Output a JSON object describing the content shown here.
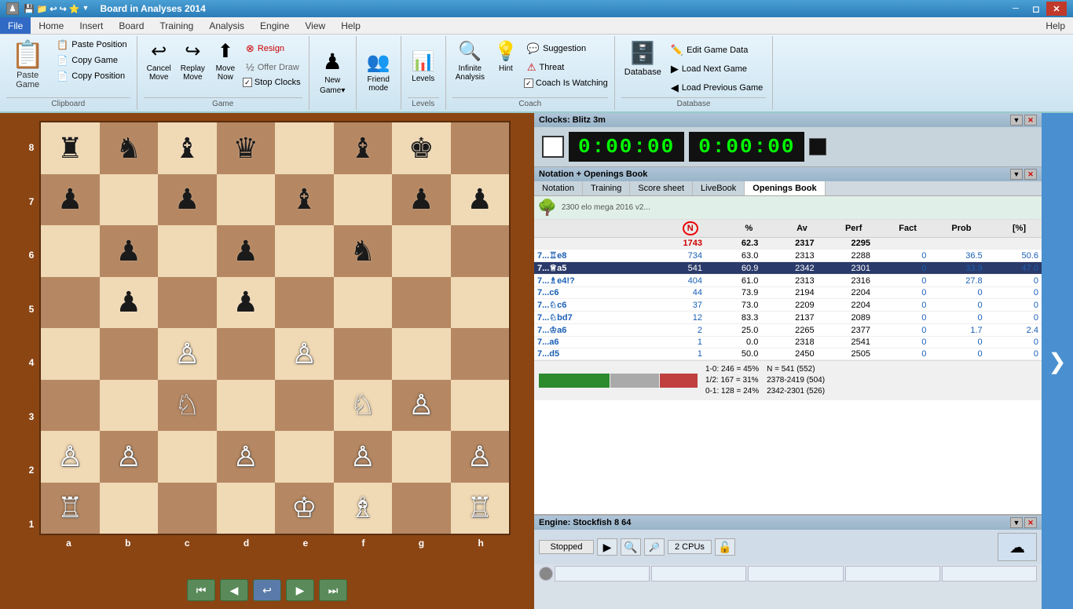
{
  "titleBar": {
    "title": "Board in Analyses 2014",
    "icons": [
      "disk",
      "folder",
      "undo",
      "redo",
      "star"
    ],
    "controls": [
      "minimize",
      "restore",
      "close"
    ]
  },
  "menuBar": {
    "items": [
      "File",
      "Home",
      "Insert",
      "Board",
      "Training",
      "Analysis",
      "Engine",
      "View",
      "Help"
    ],
    "active": "Home",
    "help": "Help"
  },
  "ribbon": {
    "clipboard": {
      "label": "Clipboard",
      "pasteLabel": "Paste Game",
      "items": [
        {
          "label": "Paste Position",
          "icon": "📋"
        },
        {
          "label": "Copy Game",
          "icon": "📄"
        },
        {
          "label": "Copy Position",
          "icon": "📄"
        }
      ]
    },
    "game": {
      "label": "Game",
      "cancelLabel": "Cancel Move",
      "replayLabel": "Replay Move",
      "moveNowLabel": "Move Now",
      "resignLabel": "Resign",
      "drawLabel": "Offer Draw",
      "stopClocksLabel": "Stop Clocks"
    },
    "newGame": {
      "label": "New Game",
      "icon": "♟"
    },
    "friendMode": {
      "label": "Friend mode"
    },
    "levels": {
      "label": "Levels"
    },
    "coach": {
      "label": "Coach",
      "suggestionLabel": "Suggestion",
      "threatLabel": "Threat",
      "infiniteLabel": "Infinite Analysis",
      "hintLabel": "Hint",
      "coachWatchingLabel": "Coach Is Watching"
    },
    "database": {
      "label": "Database",
      "editGameData": "Edit Game Data",
      "loadNextGame": "Load Next Game",
      "loadPreviousGame": "Load Previous Game"
    }
  },
  "clocks": {
    "header": "Clocks: Blitz 3m",
    "white": "0:00:00",
    "black": "0:00:00"
  },
  "notation": {
    "header": "Notation + Openings Book",
    "tabs": [
      "Notation",
      "Training",
      "Score sheet",
      "LiveBook",
      "Openings Book"
    ],
    "activeTab": "Openings Book"
  },
  "openingsBook": {
    "treeInfo": "2300 elo mega 2016 v2...",
    "columns": [
      "N",
      "%",
      "Av",
      "Perf",
      "Fact",
      "Prob",
      "[%]"
    ],
    "totalN": "1743",
    "totalPct": "62.3",
    "totalAv": "2317",
    "totalPerf": "2295",
    "moves": [
      {
        "move": "7...♖e8",
        "n": "734",
        "pct": "63.0",
        "av": "2313",
        "perf": "2288",
        "fact": "0",
        "prob": "36.5",
        "pctbig": "50.6",
        "selected": false
      },
      {
        "move": "7...♕a5",
        "n": "541",
        "pct": "60.9",
        "av": "2342",
        "perf": "2301",
        "fact": "0",
        "prob": "33.9",
        "pctbig": "47.0",
        "selected": true
      },
      {
        "move": "7...♗e4!?",
        "n": "404",
        "pct": "61.0",
        "av": "2313",
        "perf": "2316",
        "fact": "0",
        "prob": "27.8",
        "pctbig": "0",
        "selected": false
      },
      {
        "move": "7...c6",
        "n": "44",
        "pct": "73.9",
        "av": "2194",
        "perf": "2204",
        "fact": "0",
        "prob": "0",
        "pctbig": "0",
        "selected": false
      },
      {
        "move": "7...♘c6",
        "n": "37",
        "pct": "73.0",
        "av": "2209",
        "perf": "2204",
        "fact": "0",
        "prob": "0",
        "pctbig": "0",
        "selected": false
      },
      {
        "move": "7...♘bd7",
        "n": "12",
        "pct": "83.3",
        "av": "2137",
        "perf": "2089",
        "fact": "0",
        "prob": "0",
        "pctbig": "0",
        "selected": false
      },
      {
        "move": "7...♔a6",
        "n": "2",
        "pct": "25.0",
        "av": "2265",
        "perf": "2377",
        "fact": "0",
        "prob": "1.7",
        "pctbig": "2.4",
        "selected": false
      },
      {
        "move": "7...a6",
        "n": "1",
        "pct": "0.0",
        "av": "2318",
        "perf": "2541",
        "fact": "0",
        "prob": "0",
        "pctbig": "0",
        "selected": false
      },
      {
        "move": "7...d5",
        "n": "1",
        "pct": "50.0",
        "av": "2450",
        "perf": "2505",
        "fact": "0",
        "prob": "0",
        "pctbig": "0",
        "selected": false
      }
    ],
    "stats": {
      "win": "1-0: 246 = 45%",
      "draw": "1/2: 167 = 31%",
      "loss": "0-1: 128 = 24%",
      "nTotal": "N = 541 (552)",
      "eloWin": "2378-2419 (504)",
      "eloLoss": "2342-2301 (526)",
      "barGreenWidth": 45,
      "barRedWidth": 24,
      "barGrayWidth": 31
    }
  },
  "engine": {
    "header": "Engine: Stockfish 8 64",
    "status": "Stopped",
    "cpus": "2 CPUs"
  },
  "board": {
    "coordsLeft": [
      "8",
      "7",
      "6",
      "5",
      "4",
      "3",
      "2",
      "1"
    ],
    "coordsBottom": [
      "a",
      "b",
      "c",
      "d",
      "e",
      "f",
      "g",
      "h"
    ],
    "controls": [
      "first",
      "prev",
      "undo",
      "next",
      "last"
    ]
  }
}
